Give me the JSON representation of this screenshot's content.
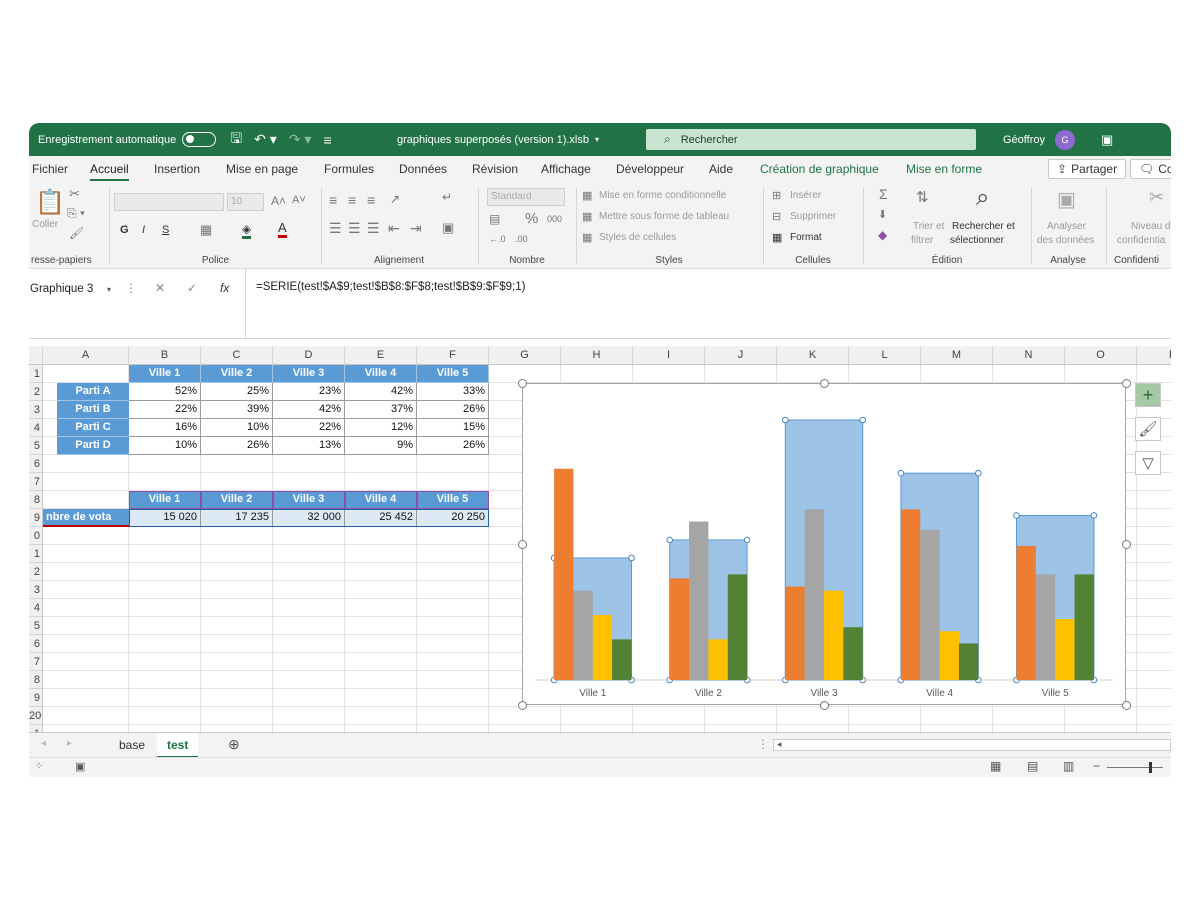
{
  "titlebar": {
    "autosave": "Enregistrement automatique",
    "filename": "graphiques superposés (version 1).xlsb",
    "search_placeholder": "Rechercher",
    "user": "Géoffroy",
    "avatar_initial": "G"
  },
  "tabs": [
    "Fichier",
    "Accueil",
    "Insertion",
    "Mise en page",
    "Formules",
    "Données",
    "Révision",
    "Affichage",
    "Développeur",
    "Aide",
    "Création de graphique",
    "Mise en forme"
  ],
  "share_label": "Partager",
  "comments_label": "Co",
  "ribbon": {
    "clipboard": {
      "label": "resse-papiers",
      "paste": "Coller"
    },
    "font": {
      "label": "Police",
      "size": "10",
      "bold": "G",
      "italic": "I",
      "underline": "S"
    },
    "alignment": {
      "label": "Alignement"
    },
    "number": {
      "label": "Nombre",
      "format": "Standard"
    },
    "styles": {
      "label": "Styles",
      "cond": "Mise en forme conditionnelle",
      "table": "Mettre sous forme de tableau",
      "cell": "Styles de cellules"
    },
    "cells": {
      "label": "Cellules",
      "insert": "Insérer",
      "delete": "Supprimer",
      "format": "Format"
    },
    "editing": {
      "label": "Édition",
      "sort1": "Trier et",
      "sort2": "filtrer",
      "find1": "Rechercher et",
      "find2": "sélectionner"
    },
    "analysis": {
      "label": "Analyse",
      "l1": "Analyser",
      "l2": "des données"
    },
    "confidential": {
      "label": "Confidenti",
      "l1": "Niveau d",
      "l2": "confidentia"
    }
  },
  "formula_bar": {
    "name_box": "Graphique 3",
    "fx": "fx",
    "formula": "=SERIE(test!$A$9;test!$B$8:$F$8;test!$B$9:$F$9;1)"
  },
  "columns": [
    "A",
    "B",
    "C",
    "D",
    "E",
    "F",
    "G",
    "H",
    "I",
    "J",
    "K",
    "L",
    "M",
    "N",
    "O",
    "P"
  ],
  "rows": [
    "1",
    "2",
    "3",
    "4",
    "5",
    "6",
    "7",
    "8",
    "9",
    "0",
    "1",
    "2",
    "3",
    "4",
    "5",
    "6",
    "7",
    "8",
    "9",
    "20",
    "1"
  ],
  "table1": {
    "headers": [
      "Ville 1",
      "Ville 2",
      "Ville 3",
      "Ville 4",
      "Ville 5"
    ],
    "rows": [
      {
        "label": "Parti A",
        "values": [
          "52%",
          "25%",
          "23%",
          "42%",
          "33%"
        ]
      },
      {
        "label": "Parti B",
        "values": [
          "22%",
          "39%",
          "42%",
          "37%",
          "26%"
        ]
      },
      {
        "label": "Parti C",
        "values": [
          "16%",
          "10%",
          "22%",
          "12%",
          "15%"
        ]
      },
      {
        "label": "Parti D",
        "values": [
          "10%",
          "26%",
          "13%",
          "9%",
          "26%"
        ]
      }
    ]
  },
  "table2": {
    "headers": [
      "Ville 1",
      "Ville 2",
      "Ville 3",
      "Ville 4",
      "Ville 5"
    ],
    "label": "nbre de vota",
    "values": [
      "15 020",
      "17 235",
      "32 000",
      "25 452",
      "20 250"
    ]
  },
  "chart_data": {
    "type": "bar",
    "categories": [
      "Ville 1",
      "Ville 2",
      "Ville 3",
      "Ville 4",
      "Ville 5"
    ],
    "total_votes": [
      15020,
      17235,
      32000,
      25452,
      20250
    ],
    "series": [
      {
        "values": [
          52,
          25,
          23,
          42,
          33
        ],
        "color": "#ed7d31"
      },
      {
        "values": [
          22,
          39,
          42,
          37,
          26
        ],
        "color": "#a5a5a5"
      },
      {
        "values": [
          16,
          10,
          22,
          12,
          15
        ],
        "color": "#ffc000"
      },
      {
        "values": [
          10,
          26,
          13,
          9,
          26
        ],
        "color": "#548235"
      }
    ],
    "background_color": "#9dc3e6",
    "ylim_votes": [
      0,
      32000
    ],
    "ylim_percent": [
      0,
      64
    ]
  },
  "sheets": [
    "base",
    "test"
  ],
  "active_sheet": "test"
}
